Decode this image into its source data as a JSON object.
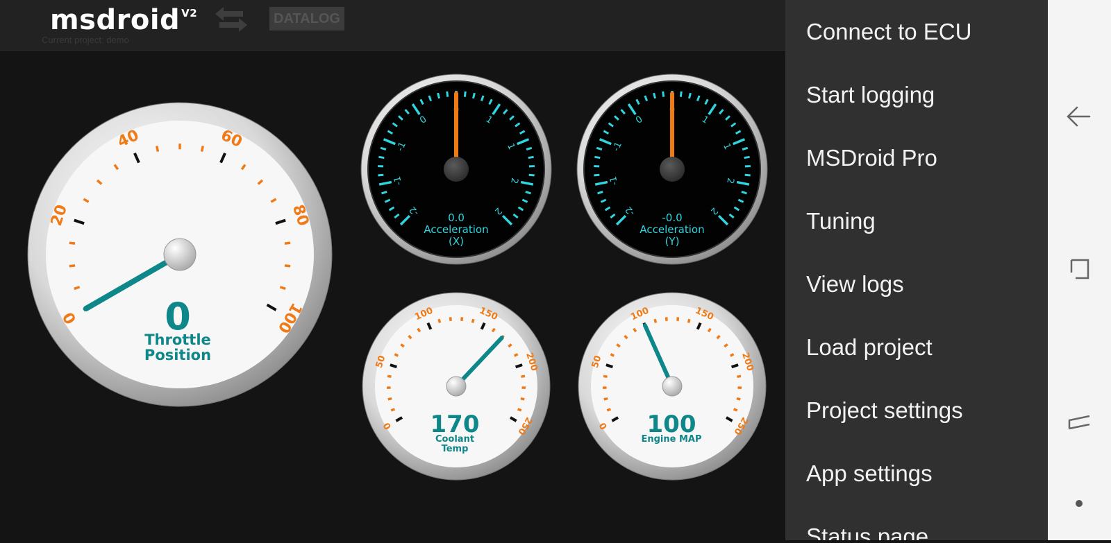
{
  "header": {
    "logo_text": "msdroid",
    "logo_version": "V2",
    "project_label": "Current project: demo",
    "datalog_label": "DATALOG"
  },
  "gauges": {
    "throttle": {
      "value": "0",
      "label_line1": "Throttle",
      "label_line2": "Position",
      "scale": [
        "0",
        "20",
        "40",
        "60",
        "80",
        "100"
      ],
      "needle_value": 0,
      "range": [
        0,
        100
      ]
    },
    "accel_x": {
      "value": "0.0",
      "label_line1": "Acceleration",
      "label_line2": "(X)",
      "scale": [
        "-2",
        "-1",
        "-1",
        "0",
        "0",
        "1",
        "1",
        "2",
        "2"
      ],
      "needle_value": 0,
      "range": [
        -2,
        2
      ]
    },
    "accel_y": {
      "value": "-0.0",
      "label_line1": "Acceleration",
      "label_line2": "(Y)",
      "scale": [
        "-2",
        "-1",
        "-1",
        "0",
        "0",
        "1",
        "1",
        "2",
        "2"
      ],
      "needle_value": 0,
      "range": [
        -2,
        2
      ]
    },
    "coolant": {
      "value": "170",
      "label_line1": "Coolant",
      "label_line2": "Temp",
      "scale": [
        "0",
        "50",
        "100",
        "150",
        "200",
        "250"
      ],
      "needle_value": 170,
      "range": [
        0,
        250
      ]
    },
    "map": {
      "value": "100",
      "label_line1": "Engine MAP",
      "scale": [
        "0",
        "50",
        "100",
        "150",
        "200",
        "250"
      ],
      "needle_value": 100,
      "range": [
        0,
        250
      ]
    }
  },
  "menu": {
    "items": [
      {
        "label": "Connect to ECU"
      },
      {
        "label": "Start logging"
      },
      {
        "label": "MSDroid Pro"
      },
      {
        "label": "Tuning"
      },
      {
        "label": "View logs"
      },
      {
        "label": "Load project"
      },
      {
        "label": "Project settings"
      },
      {
        "label": "App settings"
      },
      {
        "label": "Status page"
      }
    ]
  },
  "navbar": {
    "back_icon": "back-icon",
    "recents_icon": "recents-icon",
    "home_icon": "home-icon",
    "dot_icon": "assistant-dot-icon"
  },
  "colors": {
    "orange": "#f07a16",
    "teal": "#0d8789",
    "cyan": "#2fd6e0",
    "menu_bg": "#303030"
  }
}
